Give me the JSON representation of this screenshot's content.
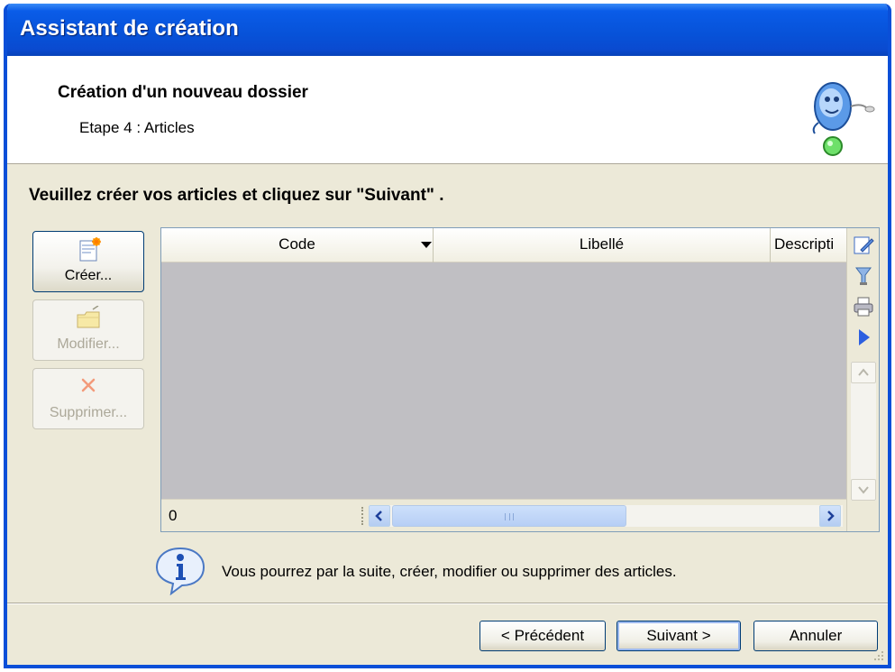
{
  "window": {
    "title": "Assistant de création"
  },
  "header": {
    "title": "Création d'un nouveau dossier",
    "subtitle": "Etape 4 : Articles",
    "mascot_icon": "wizard-mascot-icon"
  },
  "instruction": "Veuillez créer vos articles et cliquez sur \"Suivant\" .",
  "side_buttons": {
    "create": {
      "label": "Créer...",
      "icon": "new-document-icon",
      "enabled": true
    },
    "edit": {
      "label": "Modifier...",
      "icon": "folder-edit-icon",
      "enabled": false
    },
    "delete": {
      "label": "Supprimer...",
      "icon": "delete-x-icon",
      "enabled": false
    }
  },
  "grid": {
    "columns": [
      "Code",
      "Libellé",
      "Descripti"
    ],
    "rows": [],
    "record_count": "0",
    "tools": [
      "edit-grid-icon",
      "filter-icon",
      "print-icon",
      "play-icon"
    ]
  },
  "info": {
    "icon": "info-icon",
    "text": "Vous pourrez par la suite, créer, modifier ou supprimer des articles."
  },
  "footer": {
    "prev_label": "< Précédent",
    "next_label": "Suivant >",
    "cancel_label": "Annuler"
  },
  "colors": {
    "title_bar": "#0752d8",
    "dialog_background": "#ece9d8",
    "grid_empty": "#c0bfc3",
    "button_border": "#003c74"
  }
}
